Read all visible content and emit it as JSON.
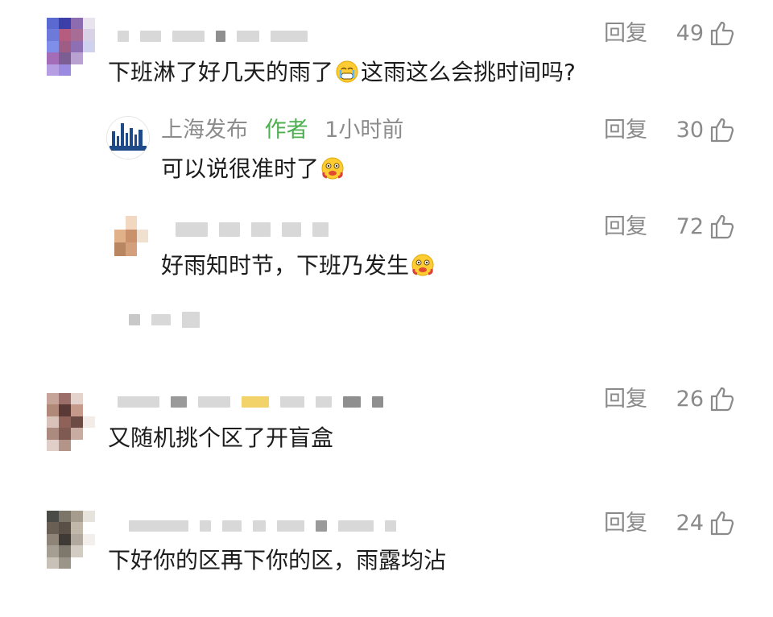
{
  "comments": [
    {
      "text": "下班淋了好几天的雨了",
      "text_after": "这雨这么会挑时间吗?",
      "reply_label": "回复",
      "likes": "49"
    },
    {
      "name": "上海发布",
      "tag": "作者",
      "time": "1小时前",
      "text": "可以说很准时了",
      "reply_label": "回复",
      "likes": "30"
    },
    {
      "text": "好雨知时节，下班乃发生",
      "reply_label": "回复",
      "likes": "72"
    },
    {
      "text": "又随机挑个区了开盲盒",
      "reply_label": "回复",
      "likes": "26"
    },
    {
      "text": "下好你的区再下你的区，雨露均沾",
      "reply_label": "回复",
      "likes": "24"
    }
  ],
  "colors": {
    "author_tag": "#4caf50",
    "meta_gray": "#8a8a8a",
    "logo_blue": "#1f4a8a"
  },
  "icons": {
    "like": "thumbs-up-icon",
    "emoji_cry": "crying-emoji",
    "emoji_cheeky": "smirk-emoji"
  }
}
